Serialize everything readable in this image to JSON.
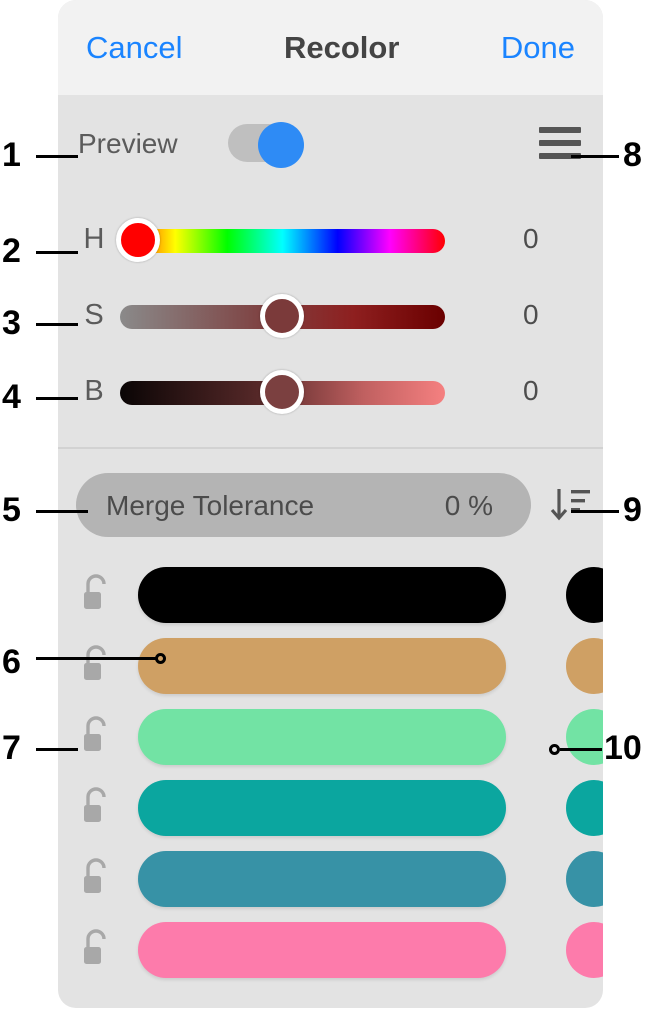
{
  "header": {
    "cancel_label": "Cancel",
    "title": "Recolor",
    "done_label": "Done"
  },
  "preview": {
    "label": "Preview",
    "toggle_state": "on",
    "toggle_on_color": "#2e8bf5",
    "toggle_track_color": "#bfbfbf",
    "menu_icon": "hamburger-menu-icon"
  },
  "sliders": [
    {
      "letter": "H",
      "value": "0",
      "thumb_color": "#ff0000",
      "thumb_position_pct": 0
    },
    {
      "letter": "S",
      "value": "0",
      "thumb_color": "#7b3a3a",
      "thumb_position_pct": 50
    },
    {
      "letter": "B",
      "value": "0",
      "thumb_color": "#7b4040",
      "thumb_position_pct": 50
    }
  ],
  "merge": {
    "label": "Merge Tolerance",
    "value": "0 %",
    "pill_color": "#b4b4b4",
    "sort_icon": "sort-descending-icon"
  },
  "colors": [
    {
      "hex": "#000000",
      "locked": false,
      "lock_icon": "unlock-icon"
    },
    {
      "hex": "#cfa064",
      "locked": false,
      "lock_icon": "unlock-icon"
    },
    {
      "hex": "#72e3a4",
      "locked": false,
      "lock_icon": "unlock-icon"
    },
    {
      "hex": "#0ba69f",
      "locked": false,
      "lock_icon": "unlock-icon"
    },
    {
      "hex": "#3792a6",
      "locked": false,
      "lock_icon": "unlock-icon"
    },
    {
      "hex": "#fd7bab",
      "locked": false,
      "lock_icon": "unlock-icon"
    }
  ],
  "callouts": [
    {
      "num": "1"
    },
    {
      "num": "2"
    },
    {
      "num": "3"
    },
    {
      "num": "4"
    },
    {
      "num": "5"
    },
    {
      "num": "6"
    },
    {
      "num": "7"
    },
    {
      "num": "8"
    },
    {
      "num": "9"
    },
    {
      "num": "10"
    }
  ]
}
